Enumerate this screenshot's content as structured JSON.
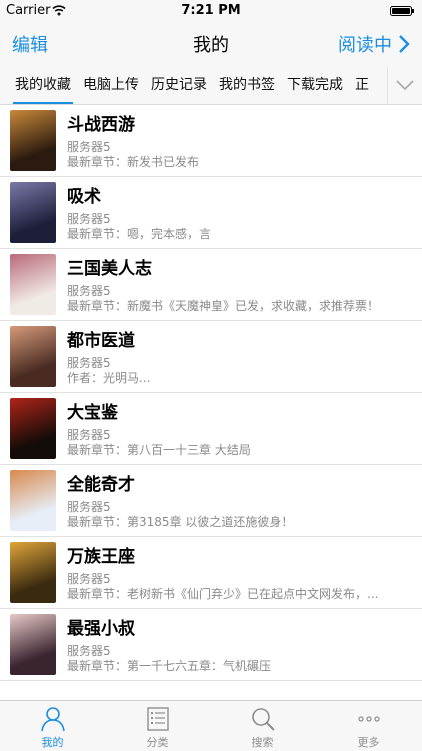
{
  "status_bar": {
    "carrier": "Carrier",
    "time": "7:21 PM"
  },
  "nav": {
    "left_label": "编辑",
    "title": "我的",
    "right_label": "阅读中"
  },
  "tabs": [
    {
      "label": "我的收藏",
      "active": true
    },
    {
      "label": "电脑上传",
      "active": false
    },
    {
      "label": "历史记录",
      "active": false
    },
    {
      "label": "我的书签",
      "active": false
    },
    {
      "label": "下载完成",
      "active": false
    },
    {
      "label": "正",
      "active": false
    }
  ],
  "books": [
    {
      "title": "斗战西游",
      "server": "服务器5",
      "latest": "最新章节：新发书已发布"
    },
    {
      "title": "吸术",
      "server": "服务器5",
      "latest": "最新章节：嗯，完本感，言"
    },
    {
      "title": "三国美人志",
      "server": "服务器5",
      "latest": "最新章节：新魔书《天魔神皇》已发，求收藏，求推荐票！"
    },
    {
      "title": "都市医道",
      "server": "服务器5",
      "latest": "作者：光明马..."
    },
    {
      "title": "大宝鉴",
      "server": "服务器5",
      "latest": "最新章节：第八百一十三章 大结局"
    },
    {
      "title": "全能奇才",
      "server": "服务器5",
      "latest": "最新章节：第3185章 以彼之道还施彼身！"
    },
    {
      "title": "万族王座",
      "server": "服务器5",
      "latest": "最新章节：老树新书《仙门弃少》已在起点中文网发布，..."
    },
    {
      "title": "最强小叔",
      "server": "服务器5",
      "latest": "最新章节：第一千七六五章：气机碾压"
    }
  ],
  "bottom_tabs": [
    {
      "label": "我的",
      "icon": "person-icon",
      "active": true
    },
    {
      "label": "分类",
      "icon": "list-icon",
      "active": false
    },
    {
      "label": "搜索",
      "icon": "search-icon",
      "active": false
    },
    {
      "label": "更多",
      "icon": "more-icon",
      "active": false
    }
  ],
  "colors": {
    "accent": "#1a8fe0",
    "bar_bg": "#f7f7f7",
    "secondary_text": "#8a8a8a"
  }
}
